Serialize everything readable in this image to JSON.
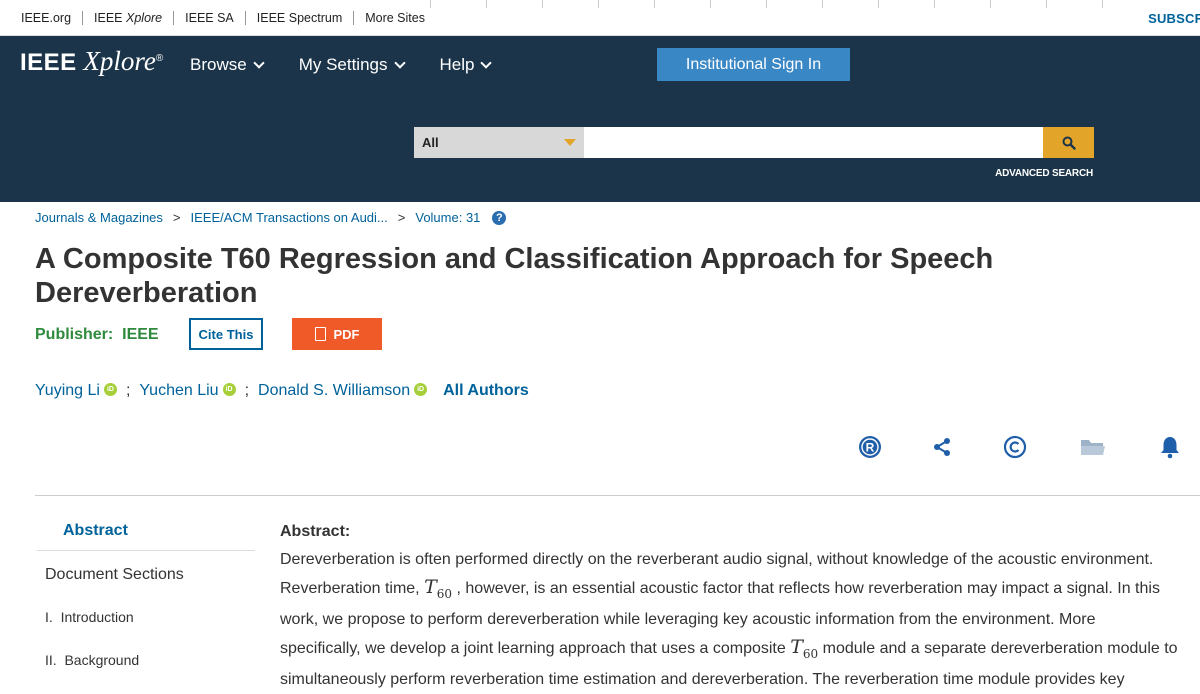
{
  "topbar": {
    "links": [
      "IEEE.org",
      "IEEE Xplore",
      "IEEE SA",
      "IEEE Spectrum",
      "More Sites"
    ],
    "subscribe": "SUBSCRI"
  },
  "header": {
    "logo_ieee": "IEEE",
    "logo_xplore": "Xplore",
    "logo_reg": "®",
    "nav": [
      "Browse",
      "My Settings",
      "Help"
    ],
    "signin": "Institutional Sign In",
    "search_scope": "All",
    "search_placeholder": "",
    "advanced_search": "ADVANCED SEARCH"
  },
  "breadcrumb": [
    "Journals & Magazines",
    "IEEE/ACM Transactions on Audi...",
    "Volume: 31"
  ],
  "article": {
    "title": "A Composite T60 Regression and Classification Approach for Speech Dereverberation",
    "publisher_label": "Publisher:",
    "publisher": "IEEE",
    "cite_label": "Cite This",
    "pdf_label": "PDF",
    "authors": [
      "Yuying Li",
      "Yuchen Liu",
      "Donald S. Williamson"
    ],
    "all_authors": "All Authors"
  },
  "tools": [
    "rights-icon",
    "share-icon",
    "copyright-icon",
    "folder-icon",
    "bell-icon"
  ],
  "sidebar": {
    "abstract": "Abstract",
    "sections_label": "Document Sections",
    "sections": [
      {
        "num": "I.",
        "label": "Introduction"
      },
      {
        "num": "II.",
        "label": "Background"
      }
    ]
  },
  "abstract": {
    "heading": "Abstract:",
    "p1": "Dereverberation is often performed directly on the reverberant audio signal, without knowledge of the acoustic environment.",
    "p2a": "Reverberation time,",
    "p2b": ", however, is an essential acoustic factor that reflects how reverberation may impact a signal. In this",
    "p3": "work, we propose to perform dereverberation while leveraging key acoustic information from the environment. More",
    "p4a": "specifically, we develop a joint learning approach that uses a composite",
    "p4b": "module and a separate dereverberation module to",
    "p5": "simultaneously perform reverberation time estimation and dereverberation. The reverberation time module provides key",
    "math_T": "T",
    "math_sub": "60"
  }
}
